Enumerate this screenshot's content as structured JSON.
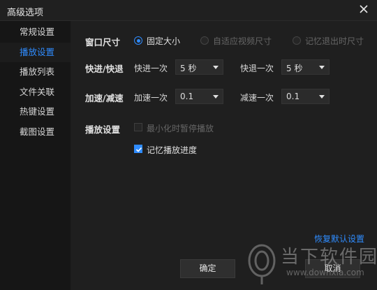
{
  "window": {
    "title": "高级选项"
  },
  "sidebar": {
    "items": [
      {
        "label": "常规设置"
      },
      {
        "label": "播放设置"
      },
      {
        "label": "播放列表"
      },
      {
        "label": "文件关联"
      },
      {
        "label": "热键设置"
      },
      {
        "label": "截图设置"
      }
    ],
    "active_index": 1
  },
  "window_size": {
    "label": "窗口尺寸",
    "options": [
      {
        "label": "固定大小",
        "selected": true,
        "enabled": true
      },
      {
        "label": "自适应视频尺寸",
        "selected": false,
        "enabled": false
      },
      {
        "label": "记忆退出时尺寸",
        "selected": false,
        "enabled": false
      }
    ]
  },
  "seek": {
    "label": "快进/快退",
    "forward_label": "快进一次",
    "forward_value": "5 秒",
    "backward_label": "快退一次",
    "backward_value": "5 秒"
  },
  "speed": {
    "label": "加速/减速",
    "up_label": "加速一次",
    "up_value": "0.1",
    "down_label": "减速一次",
    "down_value": "0.1"
  },
  "playback": {
    "label": "播放设置",
    "pause_on_minimize": {
      "label": "最小化时暂停播放",
      "checked": false,
      "enabled": false
    },
    "remember_progress": {
      "label": "记忆播放进度",
      "checked": true,
      "enabled": true
    }
  },
  "footer": {
    "restore_defaults": "恢复默认设置",
    "ok": "确定",
    "cancel": "取消"
  },
  "watermark": {
    "brand": "当下软件园",
    "url": "www.downxia.com"
  },
  "colors": {
    "accent": "#2f8cff",
    "background": "#1f1f1f",
    "sidebar": "#161616"
  }
}
